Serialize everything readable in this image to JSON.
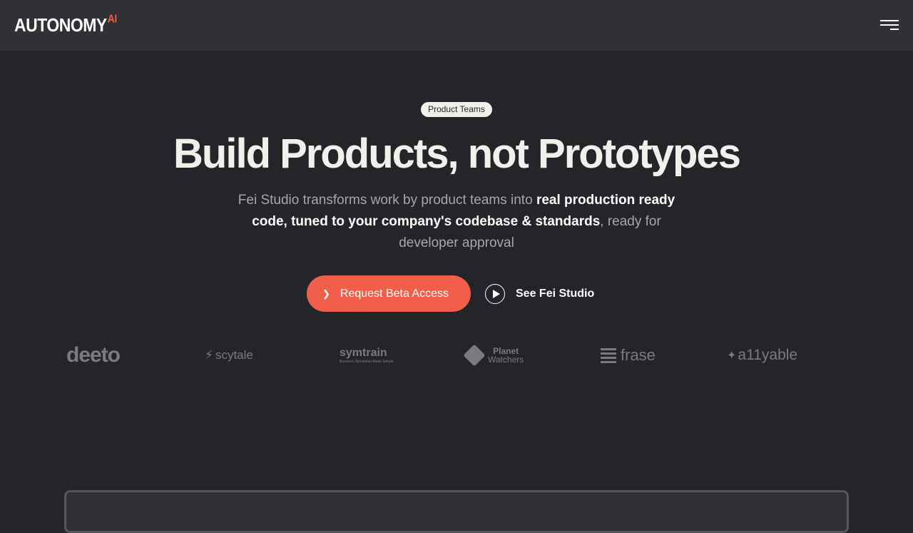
{
  "header": {
    "logo_text": "AUTONOMY",
    "logo_sup": "AI",
    "menu_icon": "hamburger-menu-icon"
  },
  "hero": {
    "badge": "Product Teams",
    "headline": "Build Products, not Prototypes",
    "sub_part1": "Fei Studio transforms work by product teams into ",
    "sub_bold": "real production ready code, tuned to your company's codebase & standards",
    "sub_part2": ", ready for developer approval",
    "cta_label": "Request Beta Access",
    "watch_label": "See Fei Studio"
  },
  "logos": {
    "deeto": "deeto",
    "scytale": "scytale",
    "symtrain": "symtrain",
    "symtrain_tagline": "Business Simulation Made Simple",
    "planet_line1": "Planet",
    "planet_line2": "Watchers",
    "frase": "frase",
    "allyable": "a11yable"
  },
  "colors": {
    "background": "#242529",
    "navbar": "#303135",
    "accent": "#f15e4a",
    "logo_gray": "#7b7b7f"
  }
}
